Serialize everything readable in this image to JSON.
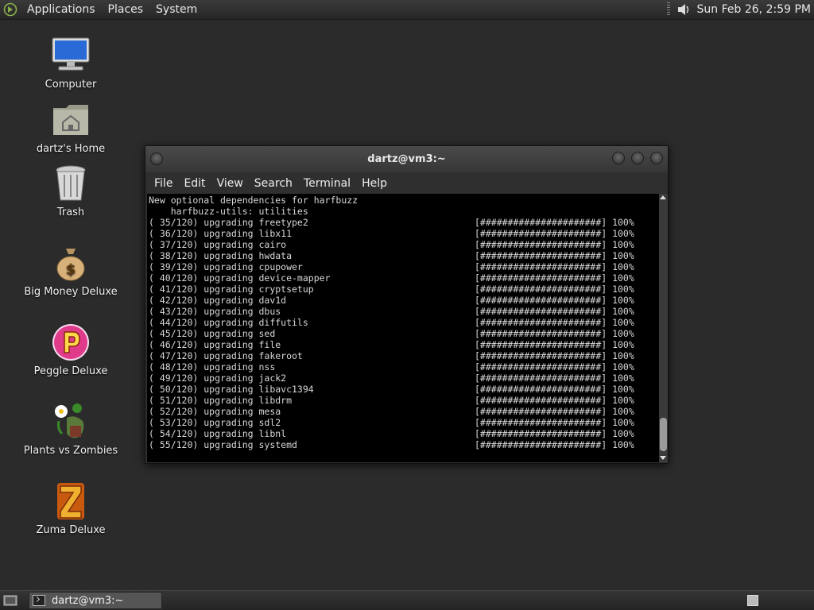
{
  "top_panel": {
    "menus": [
      "Applications",
      "Places",
      "System"
    ],
    "clock": "Sun Feb 26,  2:59 PM"
  },
  "desktop_icons": [
    {
      "label": "Computer",
      "icon": "computer-icon"
    },
    {
      "label": "dartz's Home",
      "icon": "home-folder-icon"
    },
    {
      "label": "Trash",
      "icon": "trash-icon"
    },
    {
      "label": "Big Money Deluxe",
      "icon": "money-bag-icon"
    },
    {
      "label": "Peggle Deluxe",
      "icon": "peggle-icon"
    },
    {
      "label": "Plants vs Zombies",
      "icon": "plants-zombies-icon"
    },
    {
      "label": "Zuma Deluxe",
      "icon": "zuma-icon"
    }
  ],
  "terminal": {
    "title": "dartz@vm3:~",
    "menu": [
      "File",
      "Edit",
      "View",
      "Search",
      "Terminal",
      "Help"
    ],
    "header_lines": [
      "New optional dependencies for harfbuzz",
      "    harfbuzz-utils: utilities"
    ],
    "progress_bar": "[######################] 100%",
    "upgrade_lines": [
      "( 35/120) upgrading freetype2",
      "( 36/120) upgrading libx11",
      "( 37/120) upgrading cairo",
      "( 38/120) upgrading hwdata",
      "( 39/120) upgrading cpupower",
      "( 40/120) upgrading device-mapper",
      "( 41/120) upgrading cryptsetup",
      "( 42/120) upgrading dav1d",
      "( 43/120) upgrading dbus",
      "( 44/120) upgrading diffutils",
      "( 45/120) upgrading sed",
      "( 46/120) upgrading file",
      "( 47/120) upgrading fakeroot",
      "( 48/120) upgrading nss",
      "( 49/120) upgrading jack2",
      "( 50/120) upgrading libavc1394",
      "( 51/120) upgrading libdrm",
      "( 52/120) upgrading mesa",
      "( 53/120) upgrading sdl2",
      "( 54/120) upgrading libnl",
      "( 55/120) upgrading systemd"
    ]
  },
  "taskbar": {
    "window_button": "dartz@vm3:~"
  },
  "colors": {
    "desktop": "#2b2b2b",
    "terminal_bg": "#000000",
    "terminal_fg": "#d8d8d8"
  }
}
